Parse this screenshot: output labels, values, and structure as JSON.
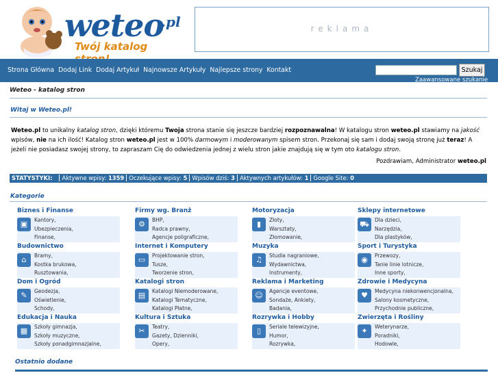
{
  "logo": {
    "word": "weteo",
    "tld": ".pl",
    "tagline": "Twój katalog stron!"
  },
  "ad": {
    "text": "reklama"
  },
  "nav": {
    "items": [
      "Strona Główna",
      "Dodaj Link",
      "Dodaj Artykuł",
      "Najnowsze Artykuły",
      "Najlepsze strony",
      "Kontakt"
    ],
    "search_button": "Szukaj",
    "advanced": "Zaawansowane szukanie"
  },
  "breadcrumb": "Weteo - katalog stron",
  "welcome": {
    "title": "Witaj w Weteo.pl!",
    "text_html": "<b>Weteo.pl</b> to unikalny <i>katalog stron</i>, dzięki któremu <b>Twoja</b> strona stanie się jeszcze bardziej <b>rozpoznawalna</b>! W katalogu stron <b>weteo.pl</b> stawiamy na <i>jakość</i> wpisów, <b>nie</b> na ich ilość! Katalog stron <b>weteo.pl</b> jest w 100% <i>darmowym</i> i <i>moderowanym</i> spisem stron. Przekonaj się sam i dodaj swoją stronę już <b>teraz</b>! A jeżeli nie posiadasz swojej strony, to zapraszam Cię do odwiedzenia jednej z wielu stron jakie znajdują się w tym oto <i>katalogu stron</i>.",
    "signature_prefix": "Pozdrawiam, Administrator",
    "signature_name": "weteo.pl"
  },
  "stats": {
    "label": "STATYSTYKI:",
    "items": [
      {
        "label": "Aktywne wpisy:",
        "value": "1359"
      },
      {
        "label": "Oczekujące wpisy:",
        "value": "5"
      },
      {
        "label": "Wpisów dziś:",
        "value": "3"
      },
      {
        "label": "Aktywnych artykułów:",
        "value": "1"
      },
      {
        "label": "Google Site:",
        "value": "0"
      }
    ]
  },
  "categories_title": "Kategorie",
  "categories": [
    {
      "name": "Biznes i Finanse",
      "subs": [
        "Kantory,",
        "Ubezpieczenia,",
        "Finanse,"
      ],
      "icon": "briefcase-icon",
      "glyph": "▣"
    },
    {
      "name": "Firmy wg. Branż",
      "subs": [
        "BHP,",
        "Radca prawny,",
        "Agencje poligraficzne,"
      ],
      "icon": "gears-icon",
      "glyph": "⚙"
    },
    {
      "name": "Motoryzacja",
      "subs": [
        "Złoty,",
        "Warsztaty,",
        "Złomowanie,"
      ],
      "icon": "traffic-light-icon",
      "glyph": "▮"
    },
    {
      "name": "Sklepy internetowe",
      "subs": [
        "Dla dzieci,",
        "Narzędzia,",
        "Dla plastyków,"
      ],
      "icon": "cart-icon",
      "glyph": "⛟"
    },
    {
      "name": "Budownictwo",
      "subs": [
        "Bramy,",
        "Kostka brukowa,",
        "Rusztowania,"
      ],
      "icon": "house-icon",
      "glyph": "⌂"
    },
    {
      "name": "Internet i Komputery",
      "subs": [
        "Projektowanie stron,",
        "Tusze,",
        "Tworzenie stron,"
      ],
      "icon": "computer-icon",
      "glyph": "▭"
    },
    {
      "name": "Muzyka",
      "subs": [
        "Studia nagraniowe,",
        "Wydawnictwa,",
        "Instrumenty,"
      ],
      "icon": "headphones-icon",
      "glyph": "♫"
    },
    {
      "name": "Sport i Turystyka",
      "subs": [
        "Przewozy,",
        "Tanie linie lotnicze,",
        "Inne sporty,"
      ],
      "icon": "camera-icon",
      "glyph": "◉"
    },
    {
      "name": "Dom i Ogród",
      "subs": [
        "Geodezja,",
        "Oświetlenie,",
        "Schody,"
      ],
      "icon": "wrench-icon",
      "glyph": "✎"
    },
    {
      "name": "Katalogi stron",
      "subs": [
        "Katalogi Niemoderowane,",
        "Katalogi Tematyczne,",
        "Katalogi Płatne,"
      ],
      "icon": "folder-icon",
      "glyph": "▤"
    },
    {
      "name": "Reklama i Marketing",
      "subs": [
        "Agencje eventowe,",
        "Sondaże, Ankiety,",
        "Badania,"
      ],
      "icon": "people-icon",
      "glyph": "☺"
    },
    {
      "name": "Zdrowie i Medycyna",
      "subs": [
        "Medycyna niekonwencjonalna,",
        "Salony kosmetyczne,",
        "Przychodnie publiczne,"
      ],
      "icon": "heart-icon",
      "glyph": "♥"
    },
    {
      "name": "Edukacja i Nauka",
      "subs": [
        "Szkoły gimnazja,",
        "Szkoły muzyczne,",
        "Szkoły ponadgimnazjalne,"
      ],
      "icon": "document-icon",
      "glyph": "▦"
    },
    {
      "name": "Kultura i Sztuka",
      "subs": [
        "Teatry,",
        "Gazety, Dzienniki,",
        "Opery,"
      ],
      "icon": "film-icon",
      "glyph": "✂"
    },
    {
      "name": "Rozrywka i Hobby",
      "subs": [
        "Seriale telewizyjne,",
        "Humor,",
        "Rozrywka,"
      ],
      "icon": "mobile-icon",
      "glyph": "▯"
    },
    {
      "name": "Zwierzęta i Rośliny",
      "subs": [
        "Weterynarze,",
        "Poradniki,",
        "Hodowle,"
      ],
      "icon": "butterfly-icon",
      "glyph": "✦"
    }
  ],
  "recent_title": "Ostatnio dodane"
}
